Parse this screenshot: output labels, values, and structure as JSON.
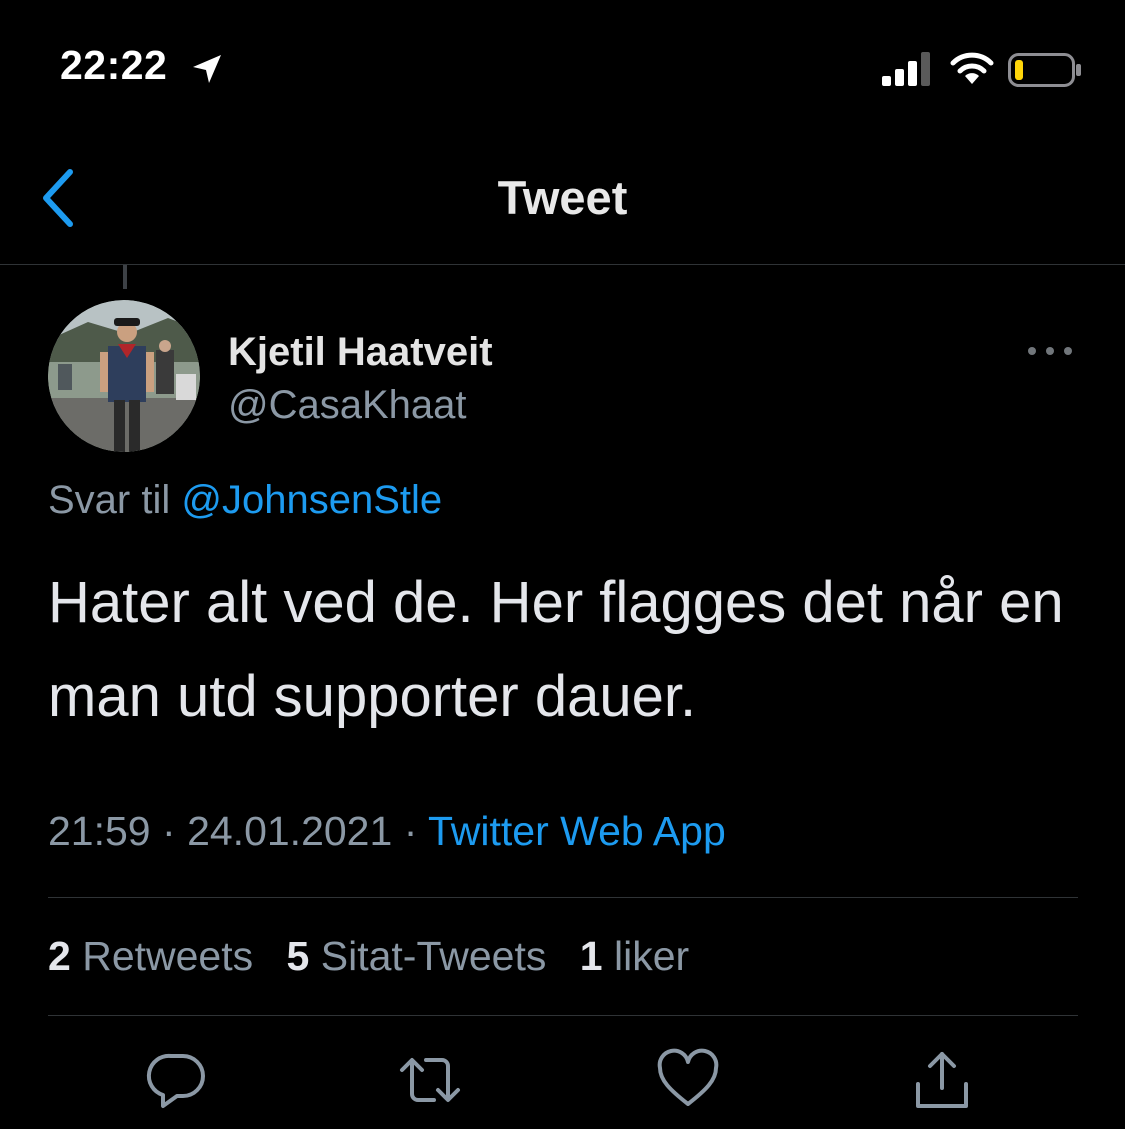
{
  "status_bar": {
    "time": "22:22",
    "icons": [
      "location-arrow-icon",
      "cellular-signal-icon",
      "wifi-icon",
      "battery-low-icon"
    ],
    "battery_color": "#ffd60a"
  },
  "nav": {
    "back_icon": "chevron-left-icon",
    "title": "Tweet",
    "accent_color": "#1d9bf0"
  },
  "tweet": {
    "author_name": "Kjetil Haatveit",
    "author_handle": "@CasaKhaat",
    "more_icon": "more-horizontal-icon",
    "reply_prefix": "Svar til",
    "reply_handle": "@JohnsenStle",
    "text": "Hater alt ved de. Her flagges det når en man utd supporter dauer.",
    "time": "21:59",
    "separator": "·",
    "date": "24.01.2021",
    "source": "Twitter Web App"
  },
  "stats": {
    "retweets_count": "2",
    "retweets_label": "Retweets",
    "quotes_count": "5",
    "quotes_label": "Sitat-Tweets",
    "likes_count": "1",
    "likes_label": "liker"
  },
  "actions": [
    "reply-icon",
    "retweet-icon",
    "like-heart-icon",
    "share-icon"
  ]
}
